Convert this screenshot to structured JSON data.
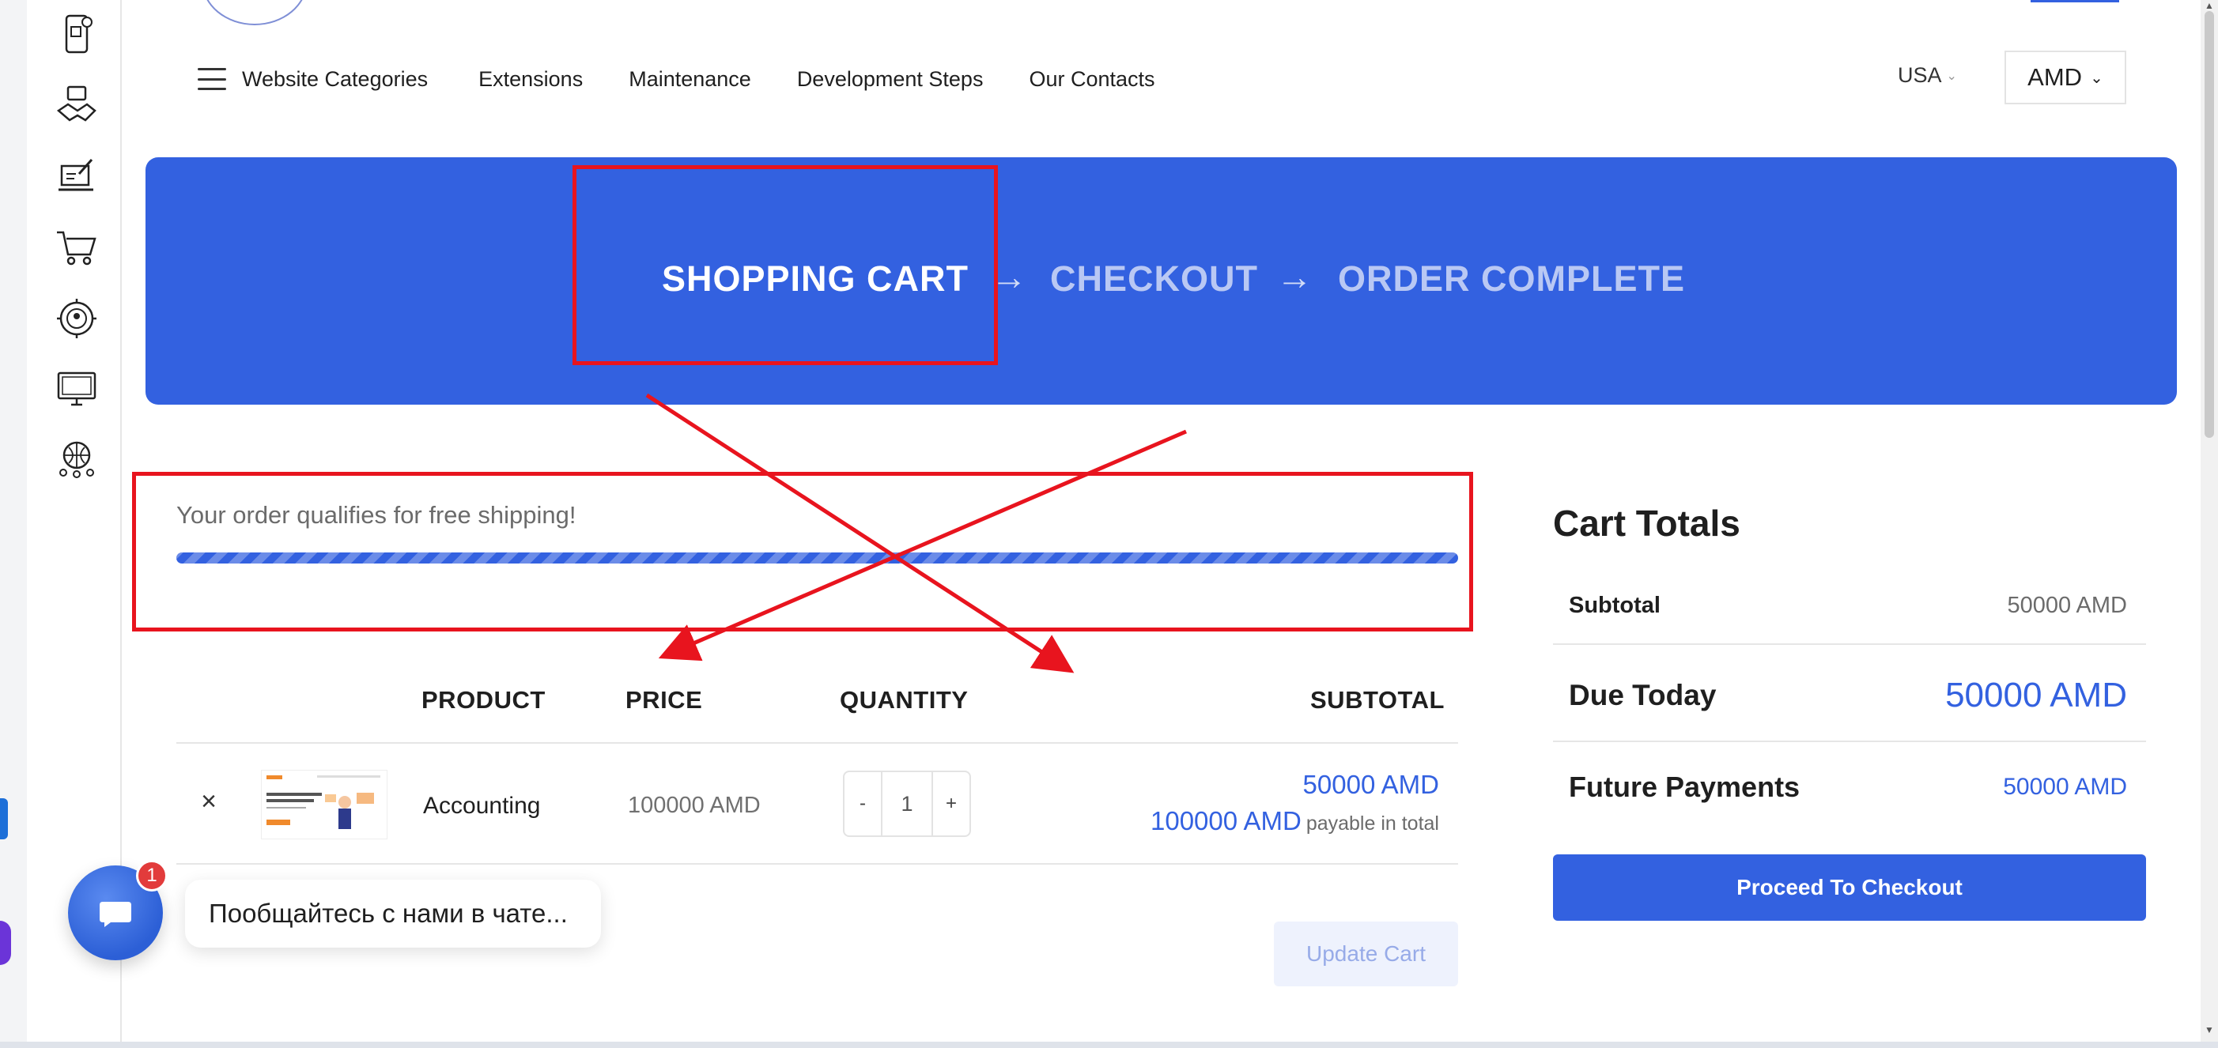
{
  "nav": {
    "menu_label": "Website Categories",
    "items": [
      "Extensions",
      "Maintenance",
      "Development Steps",
      "Our Contacts"
    ],
    "country": "USA",
    "currency": "AMD"
  },
  "sidebar": {
    "icons": [
      "mobile-shop-icon",
      "handshake-icon",
      "laptop-edit-icon",
      "shopping-cart-icon",
      "target-user-icon",
      "monitor-icon",
      "globe-people-icon"
    ]
  },
  "banner": {
    "steps": [
      "SHOPPING CART",
      "CHECKOUT",
      "ORDER COMPLETE"
    ],
    "arrow": "→"
  },
  "shipping": {
    "message": "Your order qualifies for free shipping!",
    "progress": 1.0
  },
  "table": {
    "headers": {
      "product": "PRODUCT",
      "price": "PRICE",
      "quantity": "QUANTITY",
      "subtotal": "SUBTOTAL"
    },
    "row": {
      "remove": "×",
      "name": "Accounting",
      "price": "100000 AMD",
      "qty_minus": "-",
      "qty_value": "1",
      "qty_plus": "+",
      "subtotal": "50000 AMD",
      "total_amount": "100000 AMD",
      "total_note": "payable in total"
    },
    "update_label": "Update Cart"
  },
  "totals": {
    "title": "Cart Totals",
    "subtotal_label": "Subtotal",
    "subtotal_value": "50000 AMD",
    "due_label": "Due Today",
    "due_value": "50000 AMD",
    "future_label": "Future Payments",
    "future_value": "50000 AMD",
    "checkout_label": "Proceed To Checkout"
  },
  "chat": {
    "badge": "1",
    "message": "Пообщайтесь с нами в чате..."
  },
  "colors": {
    "accent": "#3361e0",
    "annotation": "#e8141e"
  }
}
